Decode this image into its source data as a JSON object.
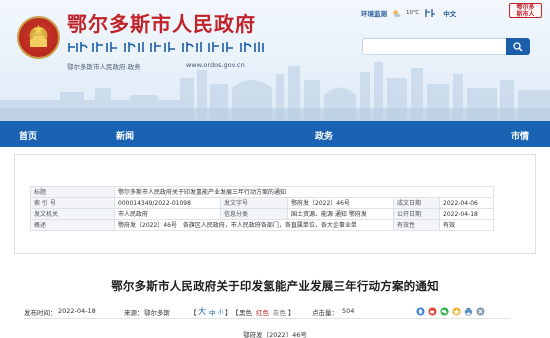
{
  "header": {
    "site_title": "鄂尔多斯市人民政府",
    "subtitle": "鄂尔多斯市人民政府.政务",
    "domain": "www.ordos.gov.cn",
    "env_link": "环境监测",
    "temperature": "10℃",
    "language_link": "中文",
    "seal_text": "鄂尔多斯市人民政府",
    "search_placeholder": "",
    "colors": {
      "brand_red": "#c0232a",
      "brand_blue": "#1a63b3"
    }
  },
  "nav": {
    "items": [
      "首页",
      "新闻",
      "政务",
      "市情"
    ]
  },
  "info": {
    "rows": [
      {
        "l1": "标题",
        "v1": "鄂尔多斯市人民政府关于印发氢能产业发展三年行动方案的通知"
      },
      {
        "l1": "索 引 号",
        "v1": "000014349/2022-01098",
        "l2": "发文字号",
        "v2": "鄂府发〔2022〕46号",
        "l3": "成文日期",
        "v3": "2022-04-06"
      },
      {
        "l1": "发文机关",
        "v1": "市人民政府",
        "l2": "信息分类",
        "v2": "国土资源、能源 通知 鄂府发",
        "l3": "公开日期",
        "v3": "2022-04-18"
      },
      {
        "l1": "概述",
        "v1": "鄂府发〔2022〕46号　各旗区人民政府，市人民政府各部门，各直属单位，各大企事业单",
        "l3": "有效性",
        "v3": "有效"
      }
    ]
  },
  "article": {
    "title": "鄂尔多斯市人民政府关于印发氢能产业发展三年行动方案的通知",
    "publish_label": "发布时间：",
    "publish_date": "2022-04-18",
    "source_label": "来源：",
    "source": "鄂尔多斯",
    "font_label": "【",
    "font_large": "大",
    "font_medium": "中",
    "font_small": "小",
    "font_close": "】",
    "color_open": "【",
    "color_black": "黑色",
    "color_red": "红色",
    "color_gray": "灰色",
    "color_close": "】",
    "reads_label": "点击量：",
    "reads": "504",
    "doc_number": "鄂府发〔2022〕46号"
  }
}
